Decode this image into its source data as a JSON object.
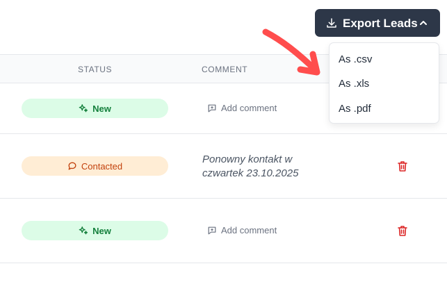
{
  "toolbar": {
    "export_label": "Export Leads",
    "icons": {
      "download": "download-icon",
      "chevron": "chevron-up-icon"
    }
  },
  "export_menu": {
    "items": [
      {
        "label": "As .csv"
      },
      {
        "label": "As .xls"
      },
      {
        "label": "As .pdf"
      }
    ]
  },
  "table": {
    "headers": {
      "status": "STATUS",
      "comment": "COMMENT"
    },
    "rows": [
      {
        "status": "New",
        "status_icon": "sparkles-icon",
        "comment_action": "Add comment",
        "comment": null,
        "has_delete": false
      },
      {
        "status": "Contacted",
        "status_icon": "chat-bubble-icon",
        "comment_action": null,
        "comment": "Ponowny kontakt w czwartek 23.10.2025",
        "has_delete": true
      },
      {
        "status": "New",
        "status_icon": "sparkles-icon",
        "comment_action": "Add comment",
        "comment": null,
        "has_delete": true
      }
    ]
  },
  "colors": {
    "button_bg": "#2d3748",
    "new_badge_bg": "#dcfce7",
    "new_badge_text": "#15803d",
    "contacted_badge_bg": "#ffedd5",
    "contacted_badge_text": "#c2410c",
    "delete_icon": "#dc2626",
    "annotation_arrow": "#ff4d4d"
  }
}
